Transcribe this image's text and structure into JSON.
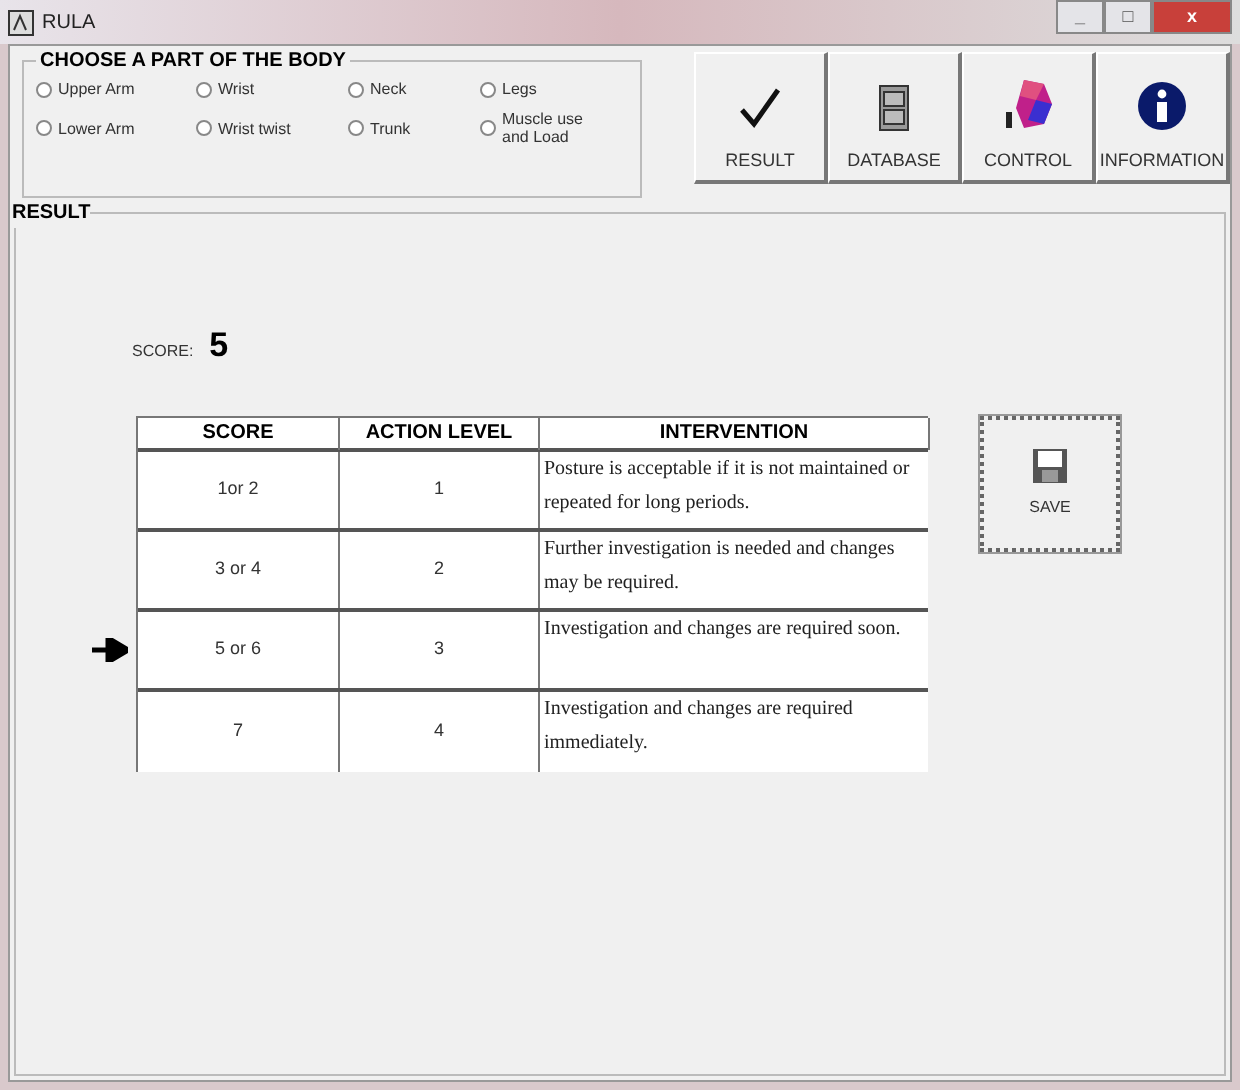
{
  "window": {
    "title": "RULA",
    "controls": [
      "_",
      "□",
      "x"
    ]
  },
  "body_parts": {
    "title": "CHOOSE A PART OF THE BODY",
    "options": [
      {
        "label": "Upper Arm",
        "selected": false
      },
      {
        "label": "Wrist",
        "selected": false
      },
      {
        "label": "Neck",
        "selected": false
      },
      {
        "label": "Legs",
        "selected": false
      },
      {
        "label": "Lower Arm",
        "selected": false
      },
      {
        "label": "Wrist twist",
        "selected": false
      },
      {
        "label": "Trunk",
        "selected": false
      },
      {
        "label": "Muscle use and Load",
        "selected": false
      }
    ]
  },
  "toolbar": [
    {
      "label": "RESULT",
      "kind": "check"
    },
    {
      "label": "DATABASE",
      "kind": "cabinet"
    },
    {
      "label": "CONTROL",
      "kind": "cube"
    },
    {
      "label": "INFORMATION",
      "kind": "info"
    }
  ],
  "result": {
    "title": "RESULT",
    "score_label": "SCORE:",
    "score": "5",
    "table": {
      "columns": [
        "SCORE",
        "ACTION LEVEL",
        "INTERVENTION"
      ],
      "rows": [
        {
          "score": "1or 2",
          "action_level": "1",
          "intervention": "Posture is acceptable if it is not maintained or repeated for long periods.",
          "selected": false
        },
        {
          "score": "3 or 4",
          "action_level": "2",
          "intervention": "Further investigation is needed and changes may be required.",
          "selected": false
        },
        {
          "score": "5 or 6",
          "action_level": "3",
          "intervention": "Investigation and changes are required soon.",
          "selected": true
        },
        {
          "score": "7",
          "action_level": "4",
          "intervention": "Investigation and changes are required immediately.",
          "selected": false
        }
      ]
    },
    "save_button": "SAVE"
  }
}
